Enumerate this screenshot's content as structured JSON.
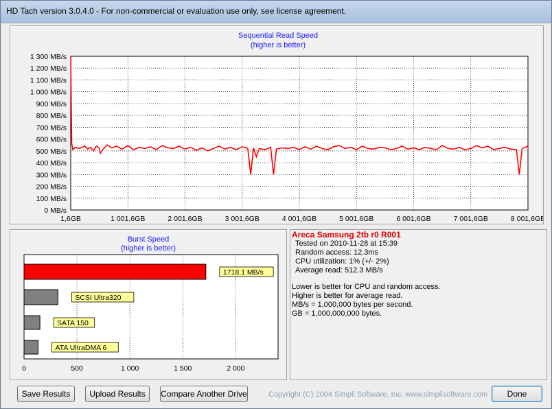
{
  "window": {
    "title": "HD Tach version 3.0.4.0  - For non-commercial or evaluation use only, see license agreement."
  },
  "sequential": {
    "title": "Sequential Read Speed",
    "subtitle": "(higher is better)",
    "y_ticks": [
      "1 300 MB/s",
      "1 200 MB/s",
      "1 100 MB/s",
      "1 000 MB/s",
      "900 MB/s",
      "800 MB/s",
      "700 MB/s",
      "600 MB/s",
      "500 MB/s",
      "400 MB/s",
      "300 MB/s",
      "200 MB/s",
      "100 MB/s",
      "0 MB/s"
    ],
    "x_ticks": [
      "1,6GB",
      "1 001,6GB",
      "2 001,6GB",
      "3 001,6GB",
      "4 001,6GB",
      "5 001,6GB",
      "6 001,6GB",
      "7 001,6GB",
      "8 001,6GE"
    ]
  },
  "burst": {
    "title": "Burst Speed",
    "subtitle": "(higher is better)",
    "x_ticks": [
      "0",
      "500",
      "1 000",
      "1 500",
      "2 000"
    ],
    "bars": [
      {
        "label": "1718.1 MB/s",
        "value": 1718.1,
        "color": "#ff0000"
      },
      {
        "label": "SCSI Ultra320",
        "value": 320,
        "color": "#808080"
      },
      {
        "label": "SATA 150",
        "value": 150,
        "color": "#808080"
      },
      {
        "label": "ATA UltraDMA 6",
        "value": 133,
        "color": "#808080"
      }
    ]
  },
  "info": {
    "device": "Areca Samsung 2tb r0 R001",
    "tested": "Tested on 2010-11-28 at 15:39",
    "random": "Random access: 12.3ms",
    "cpu": "CPU utilization: 1% (+/- 2%)",
    "avg": "Average read: 512.3 MB/s",
    "note1": "Lower is better for CPU and random access.",
    "note2": "Higher is better for average read.",
    "note3": "MB/s = 1,000,000 bytes per second.",
    "note4": "GB = 1,000,000,000 bytes."
  },
  "buttons": {
    "save": "Save Results",
    "upload": "Upload Results",
    "compare": "Compare Another Drive",
    "done": "Done"
  },
  "copyright": "Copyright (C) 2004 Simpli Software, Inc. www.simplisoftware.com",
  "chart_data": [
    {
      "type": "line",
      "title": "Sequential Read Speed",
      "subtitle": "(higher is better)",
      "ylabel": "",
      "xlabel": "",
      "ylim": [
        0,
        1300
      ],
      "xlim": [
        1.6,
        8001.6
      ],
      "grid": true,
      "series": [
        {
          "color": "#ff0000",
          "x": [
            1.6,
            20,
            40,
            80,
            150,
            250,
            300,
            350,
            400,
            450,
            500,
            520,
            560,
            640,
            720,
            800,
            900,
            1001.6,
            1100,
            1200,
            1300,
            1400,
            1500,
            1600,
            1700,
            1800,
            1900,
            2001.6,
            2100,
            2200,
            2300,
            2400,
            2500,
            2600,
            2700,
            2800,
            2900,
            3001.6,
            3100,
            3150,
            3200,
            3250,
            3300,
            3400,
            3500,
            3550,
            3600,
            3700,
            3800,
            3900,
            4001.6,
            4100,
            4200,
            4300,
            4400,
            4500,
            4600,
            4700,
            4800,
            4900,
            5001.6,
            5100,
            5200,
            5300,
            5400,
            5500,
            5600,
            5700,
            5800,
            5900,
            6001.6,
            6100,
            6200,
            6300,
            6400,
            6500,
            6600,
            6700,
            6800,
            6900,
            7001.6,
            7100,
            7200,
            7300,
            7400,
            7500,
            7600,
            7700,
            7800,
            7850,
            7900,
            8001.6
          ],
          "y": [
            1300,
            560,
            510,
            530,
            520,
            540,
            515,
            530,
            500,
            540,
            525,
            480,
            510,
            550,
            525,
            540,
            515,
            545,
            510,
            530,
            520,
            535,
            510,
            545,
            525,
            520,
            540,
            515,
            530,
            505,
            525,
            500,
            520,
            540,
            515,
            530,
            510,
            535,
            520,
            300,
            525,
            450,
            520,
            510,
            530,
            300,
            515,
            525,
            520,
            530,
            510,
            535,
            515,
            540,
            520,
            510,
            535,
            545,
            520,
            530,
            510,
            540,
            520,
            515,
            530,
            525,
            510,
            520,
            540,
            515,
            525,
            510,
            530,
            520,
            510,
            545,
            520,
            515,
            530,
            510,
            520,
            545,
            525,
            540,
            510,
            520,
            530,
            515,
            510,
            300,
            520,
            540
          ]
        }
      ]
    },
    {
      "type": "bar",
      "orientation": "horizontal",
      "title": "Burst Speed",
      "subtitle": "(higher is better)",
      "categories": [
        "1718.1 MB/s",
        "SCSI Ultra320",
        "SATA 150",
        "ATA UltraDMA 6"
      ],
      "values": [
        1718.1,
        320,
        150,
        133
      ],
      "xlim": [
        0,
        2400
      ],
      "grid": true
    }
  ]
}
